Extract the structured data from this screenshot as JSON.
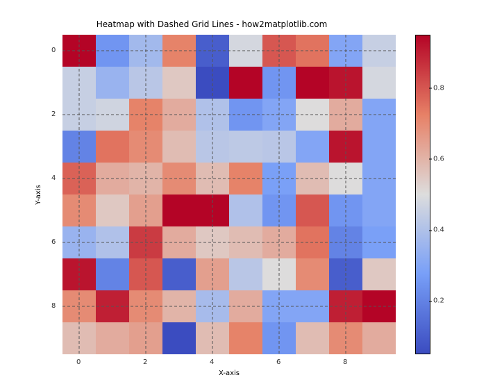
{
  "chart_data": {
    "type": "heatmap",
    "title": "Heatmap with Dashed Grid Lines - how2matplotlib.com",
    "xlabel": "X-axis",
    "ylabel": "Y-axis",
    "x_ticks": [
      0,
      2,
      4,
      6,
      8
    ],
    "y_ticks": [
      0,
      2,
      4,
      6,
      8
    ],
    "cmap": "coolwarm",
    "vrange": [
      0.05,
      0.95
    ],
    "colorbar_ticks": [
      0.2,
      0.4,
      0.6,
      0.8
    ],
    "grid": {
      "style": "dashed",
      "color": "#555"
    },
    "z": [
      [
        0.95,
        0.25,
        0.37,
        0.72,
        0.1,
        0.48,
        0.8,
        0.75,
        0.3,
        0.45
      ],
      [
        0.45,
        0.35,
        0.42,
        0.55,
        0.05,
        0.95,
        0.25,
        0.95,
        0.92,
        0.48
      ],
      [
        0.45,
        0.47,
        0.72,
        0.62,
        0.4,
        0.25,
        0.3,
        0.5,
        0.62,
        0.3
      ],
      [
        0.2,
        0.75,
        0.7,
        0.58,
        0.42,
        0.43,
        0.42,
        0.3,
        0.92,
        0.3
      ],
      [
        0.78,
        0.62,
        0.6,
        0.7,
        0.58,
        0.72,
        0.28,
        0.58,
        0.5,
        0.3
      ],
      [
        0.7,
        0.55,
        0.65,
        0.95,
        0.95,
        0.4,
        0.25,
        0.8,
        0.25,
        0.3
      ],
      [
        0.35,
        0.4,
        0.85,
        0.62,
        0.55,
        0.58,
        0.62,
        0.75,
        0.2,
        0.28
      ],
      [
        0.92,
        0.2,
        0.8,
        0.1,
        0.65,
        0.42,
        0.5,
        0.7,
        0.1,
        0.55
      ],
      [
        0.7,
        0.9,
        0.7,
        0.6,
        0.38,
        0.62,
        0.3,
        0.3,
        0.9,
        0.95
      ],
      [
        0.58,
        0.62,
        0.65,
        0.05,
        0.58,
        0.72,
        0.25,
        0.58,
        0.7,
        0.62
      ]
    ]
  }
}
